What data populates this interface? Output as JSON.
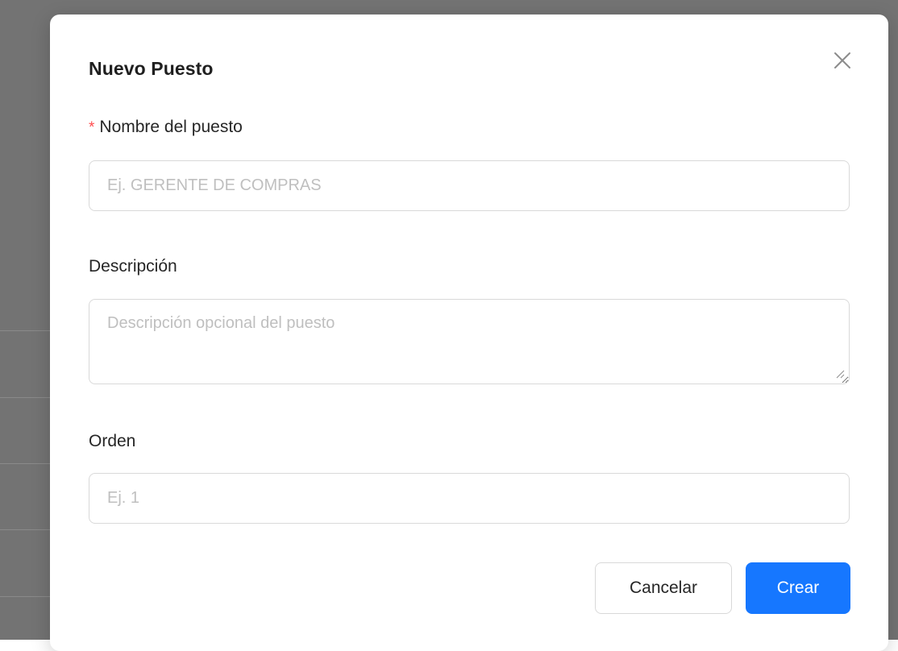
{
  "modal": {
    "title": "Nuevo Puesto",
    "close_icon": "close-icon"
  },
  "form": {
    "name": {
      "required_mark": "*",
      "label": "Nombre del puesto",
      "placeholder": "Ej. GERENTE DE COMPRAS",
      "value": ""
    },
    "description": {
      "label": "Descripción",
      "placeholder": "Descripción opcional del puesto",
      "value": ""
    },
    "order": {
      "label": "Orden",
      "placeholder": "Ej. 1",
      "value": ""
    }
  },
  "actions": {
    "cancel_label": "Cancelar",
    "create_label": "Crear"
  },
  "colors": {
    "primary": "#1677ff",
    "required": "#ff4d4f",
    "backdrop": "#737373",
    "border": "#d9d9d9",
    "placeholder": "#bfbfbf"
  }
}
